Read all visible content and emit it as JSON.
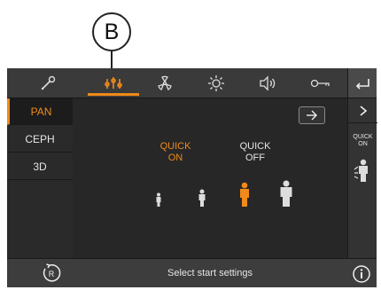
{
  "callout": {
    "letter": "B"
  },
  "tabs": [
    {
      "icon": "wrench-icon",
      "active": false
    },
    {
      "icon": "patient-positioning-icon",
      "active": true
    },
    {
      "icon": "radiation-icon",
      "active": false
    },
    {
      "icon": "brightness-icon",
      "active": false
    },
    {
      "icon": "volume-icon",
      "active": false
    },
    {
      "icon": "key-icon",
      "active": false
    }
  ],
  "sidebar": {
    "items": [
      {
        "label": "PAN",
        "active": true
      },
      {
        "label": "CEPH",
        "active": false
      },
      {
        "label": "3D",
        "active": false
      }
    ]
  },
  "main": {
    "quick_on": {
      "line1": "QUICK",
      "line2": "ON"
    },
    "quick_off": {
      "line1": "QUICK",
      "line2": "OFF"
    }
  },
  "right": {
    "quick_line1": "QUICK",
    "quick_line2": "ON"
  },
  "bottom": {
    "status": "Select start settings"
  },
  "colors": {
    "accent": "#f08a1a",
    "text": "#e6e6e6",
    "background": "#2e2e2e"
  }
}
